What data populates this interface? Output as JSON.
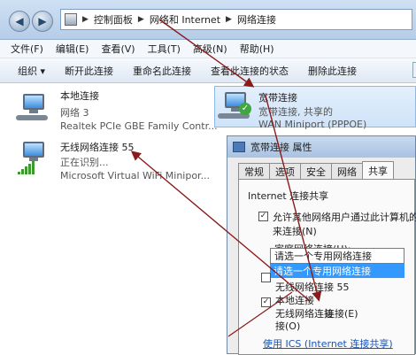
{
  "address": {
    "segments": [
      "控制面板",
      "网络和 Internet",
      "网络连接"
    ]
  },
  "menu": [
    "文件(F)",
    "编辑(E)",
    "查看(V)",
    "工具(T)",
    "高级(N)",
    "帮助(H)"
  ],
  "commands": [
    "组织 ▾",
    "断开此连接",
    "重命名此连接",
    "查看此连接的状态",
    "删除此连接"
  ],
  "connections": [
    {
      "name": "本地连接",
      "status": "网络 3",
      "device": "Realtek PCIe GBE Family Contr..."
    },
    {
      "name": "宽带连接",
      "status": "宽带连接, 共享的",
      "device": "WAN Miniport (PPPOE)"
    },
    {
      "name": "无线网络连接 55",
      "status": "正在识别...",
      "device": "Microsoft Virtual WiFi Minipor..."
    }
  ],
  "dialog": {
    "title": "宽带连接 属性",
    "tabs": [
      "常规",
      "选项",
      "安全",
      "网络",
      "共享"
    ],
    "active_tab": "共享",
    "group_title": "Internet 连接共享",
    "allow_share": "允许其他网络用户通过此计算机的",
    "allow_share_2": "来连接(N)",
    "home_label": "家庭网络连接(H):",
    "combo_value": "请选一个专用网络连接",
    "dropdown_selected": "请选一个专用网络连接",
    "dropdown_items": [
      "无线网络连接 55",
      "本地连接",
      "无线网络连接"
    ],
    "option_tail_1": "连接(E)",
    "option_tail_2": "接(O)",
    "link_text": "使用 ICS (Internet 连接共享)"
  },
  "colors": {
    "selection": "#3399ff",
    "annotation_arrow": "#8b1a1a"
  }
}
